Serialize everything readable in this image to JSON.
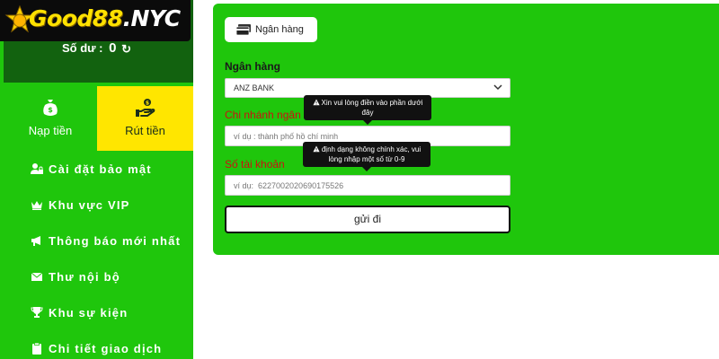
{
  "brand": {
    "logo_text": "Good88",
    "logo_suffix": ".NYC",
    "logo_icon": "gold-coin-icon"
  },
  "account": {
    "balance_label": "Số dư :",
    "balance_value": "0",
    "refresh_icon": "refresh-icon"
  },
  "actions": [
    {
      "label": "Nạp tiền",
      "icon": "money-bag-icon"
    },
    {
      "label": "Rút tiền",
      "icon": "hand-money-icon"
    }
  ],
  "menu": [
    {
      "label": "Cài đặt bảo mật",
      "icon": "user-lock-icon"
    },
    {
      "label": "Khu vực VIP",
      "icon": "crown-icon"
    },
    {
      "label": "Thông báo mới nhất",
      "icon": "megaphone-icon"
    },
    {
      "label": "Thư nội bộ",
      "icon": "envelope-icon"
    },
    {
      "label": "Khu sự kiện",
      "icon": "trophy-icon"
    },
    {
      "label": "Chi tiết giao dịch",
      "icon": "clipboard-icon"
    }
  ],
  "form": {
    "tab_label": "Ngân hàng",
    "bank_label": "Ngân hàng",
    "bank_selected": "ANZ BANK",
    "branch_label": "Chi nhánh ngân",
    "branch_placeholder": "ví dụ : thành phố hồ chí minh",
    "account_label": "Số tài khoản",
    "account_placeholder": "ví dụ:  6227002020690175526",
    "submit_label": "gửi đi",
    "tooltip_branch": "Xin vui lòng điền vào phần dưới đây",
    "tooltip_account": "định dạng không chính xác, vui lòng nhập một số từ 0-9"
  },
  "colors": {
    "primary_green": "#1fc60c",
    "dark_green": "#12620f",
    "accent_yellow": "#ffe600",
    "error_red": "#cc1111"
  }
}
